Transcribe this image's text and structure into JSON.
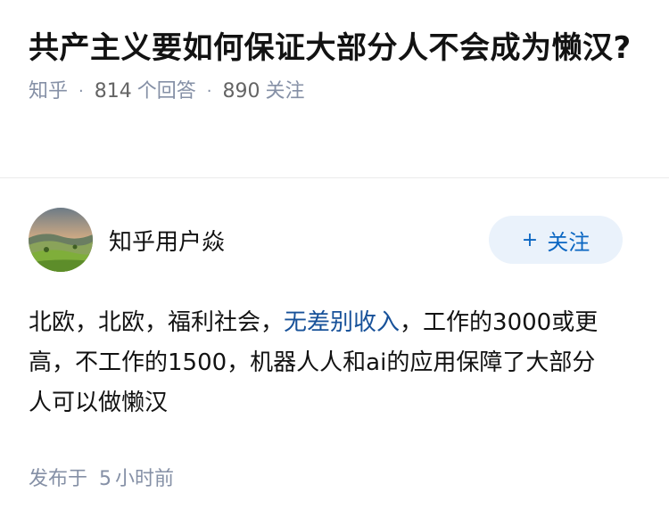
{
  "question": {
    "title": "共产主义要如何保证大部分人不会成为懒汉?",
    "source": "知乎",
    "answer_count": "814",
    "answer_suffix": "个回答",
    "follower_count": "890",
    "follower_suffix": "关注",
    "separator": "·"
  },
  "answer": {
    "author_name": "知乎用户焱",
    "follow_label": "关注",
    "follow_icon": "+",
    "content_before_link": "北欧，北欧，福利社会，",
    "content_link": "无差别收入",
    "content_after_link": "，工作的3000或更高，不工作的1500，机器人人和ai的应用保障了大部分人可以做懒汉",
    "time_prefix": "发布于",
    "time_value": "5",
    "time_suffix": "小时前"
  },
  "colors": {
    "link": "#175199",
    "meta": "#8590a6",
    "follow_bg": "#eaf2fb",
    "follow_text": "#0a66c2"
  },
  "icons": {
    "avatar": "landscape-avatar",
    "follow": "plus-icon"
  }
}
